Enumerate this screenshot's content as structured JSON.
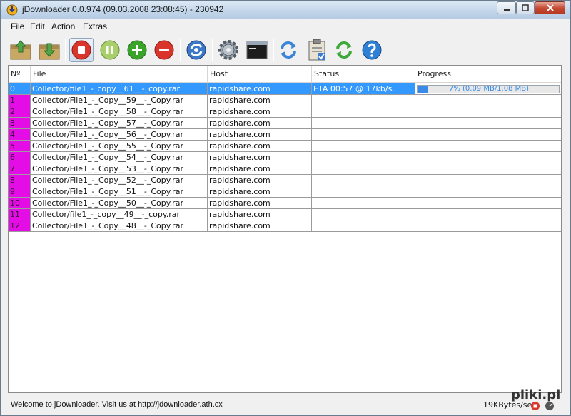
{
  "window": {
    "title": "jDownloader 0.0.974 (09.03.2008 23:08:45) - 230942"
  },
  "menu": [
    "File",
    "Edit",
    "Action",
    "Extras"
  ],
  "toolbar": {
    "buttons": [
      {
        "icon": "add-package-icon"
      },
      {
        "icon": "load-container-icon"
      },
      {
        "icon": "stop-icon",
        "active": true
      },
      {
        "icon": "pause-icon"
      },
      {
        "icon": "add-link-icon"
      },
      {
        "icon": "remove-link-icon"
      },
      {
        "icon": "reconnect-icon"
      },
      {
        "icon": "settings-icon"
      },
      {
        "icon": "log-console-icon"
      },
      {
        "icon": "update-icon"
      },
      {
        "icon": "clipboard-icon"
      },
      {
        "icon": "refresh-icon"
      },
      {
        "icon": "help-icon"
      }
    ]
  },
  "table": {
    "columns": [
      "Nº",
      "File",
      "Host",
      "Status",
      "Progress"
    ],
    "rows": [
      {
        "num": "0",
        "file": "Collector/file1_-_copy__61__-_copy.rar",
        "host": "rapidshare.com",
        "status": "ETA 00:57 @ 17kb/s.",
        "progress_text": "7% (0.09 MB/1.08 MB)",
        "progress": 0.07,
        "selected": true
      },
      {
        "num": "1",
        "file": "Collector/File1_-_Copy__59__-_Copy.rar",
        "host": "rapidshare.com",
        "status": "",
        "progress_text": "",
        "progress": null
      },
      {
        "num": "2",
        "file": "Collector/File1_-_Copy__58__-_Copy.rar",
        "host": "rapidshare.com",
        "status": "",
        "progress_text": "",
        "progress": null
      },
      {
        "num": "3",
        "file": "Collector/File1_-_Copy__57__-_Copy.rar",
        "host": "rapidshare.com",
        "status": "",
        "progress_text": "",
        "progress": null
      },
      {
        "num": "4",
        "file": "Collector/File1_-_Copy__56__-_Copy.rar",
        "host": "rapidshare.com",
        "status": "",
        "progress_text": "",
        "progress": null
      },
      {
        "num": "5",
        "file": "Collector/File1_-_Copy__55__-_Copy.rar",
        "host": "rapidshare.com",
        "status": "",
        "progress_text": "",
        "progress": null
      },
      {
        "num": "6",
        "file": "Collector/File1_-_Copy__54__-_Copy.rar",
        "host": "rapidshare.com",
        "status": "",
        "progress_text": "",
        "progress": null
      },
      {
        "num": "7",
        "file": "Collector/File1_-_Copy__53__-_Copy.rar",
        "host": "rapidshare.com",
        "status": "",
        "progress_text": "",
        "progress": null
      },
      {
        "num": "8",
        "file": "Collector/File1_-_Copy__52__-_Copy.rar",
        "host": "rapidshare.com",
        "status": "",
        "progress_text": "",
        "progress": null
      },
      {
        "num": "9",
        "file": "Collector/File1_-_Copy__51__-_Copy.rar",
        "host": "rapidshare.com",
        "status": "",
        "progress_text": "",
        "progress": null
      },
      {
        "num": "10",
        "file": "Collector/File1_-_Copy__50__-_Copy.rar",
        "host": "rapidshare.com",
        "status": "",
        "progress_text": "",
        "progress": null
      },
      {
        "num": "11",
        "file": "Collector/file1_-_copy__49__-_copy.rar",
        "host": "rapidshare.com",
        "status": "",
        "progress_text": "",
        "progress": null
      },
      {
        "num": "12",
        "file": "Collector/File1_-_Copy__48__-_Copy.rar",
        "host": "rapidshare.com",
        "status": "",
        "progress_text": "",
        "progress": null
      }
    ]
  },
  "status": {
    "message": "Welcome to jDownloader. Visit us at http://jdownloader.ath.cx",
    "speed": "19KBytes/sec"
  },
  "watermark": "pliki.pl",
  "colors": {
    "selection": "#3399ff",
    "queued_number": "#e40de6",
    "progress": "#3a8ae8"
  }
}
